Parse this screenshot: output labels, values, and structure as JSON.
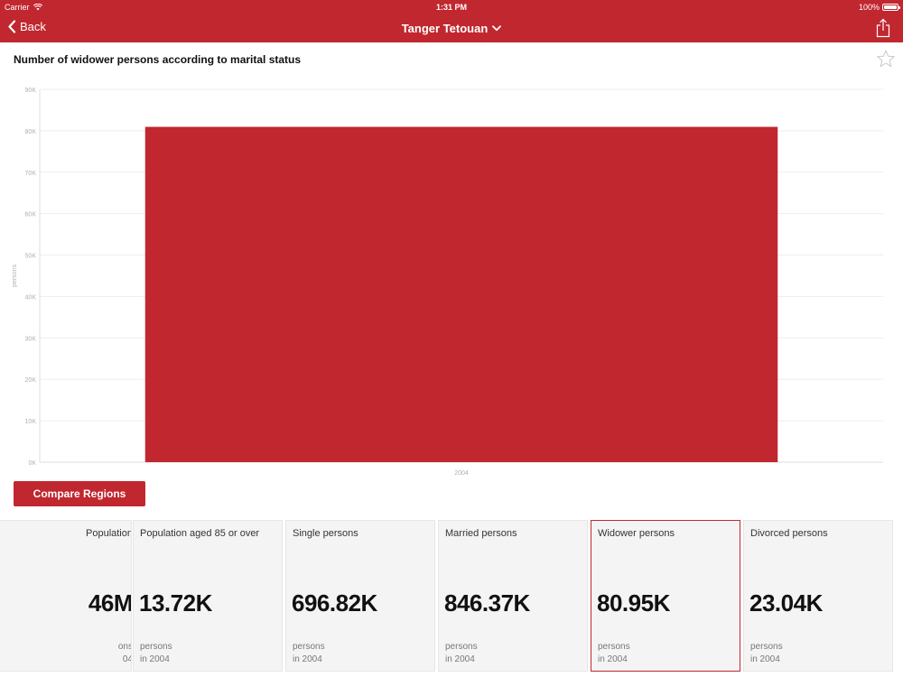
{
  "status_bar": {
    "carrier": "Carrier",
    "time": "1:31 PM",
    "battery": "100%"
  },
  "nav": {
    "back_label": "Back",
    "title": "Tanger Tetouan"
  },
  "colors": {
    "brand": "#c1272f",
    "grid": "#eeeeee",
    "axis_text": "#b0b0b0"
  },
  "chart_data": {
    "type": "bar",
    "title": "Number of widower persons according to marital status",
    "ylabel": "persons",
    "xlabel": "",
    "categories": [
      "2004"
    ],
    "values": [
      80950
    ],
    "ylim": [
      0,
      90000
    ],
    "y_ticks": [
      "0K",
      "10K",
      "20K",
      "30K",
      "40K",
      "50K",
      "60K",
      "70K",
      "80K",
      "90K"
    ],
    "grid": true,
    "bar_color": "#c1272f"
  },
  "compare_button": "Compare Regions",
  "cards": [
    {
      "label": "Population",
      "value": "46M",
      "unit": "ons",
      "year": "04",
      "clipped": true
    },
    {
      "label": "Population aged 85 or over",
      "value": "13.72K",
      "unit": "persons",
      "year": "in 2004"
    },
    {
      "label": "Single persons",
      "value": "696.82K",
      "unit": "persons",
      "year": "in 2004"
    },
    {
      "label": "Married persons",
      "value": "846.37K",
      "unit": "persons",
      "year": "in 2004"
    },
    {
      "label": "Widower persons",
      "value": "80.95K",
      "unit": "persons",
      "year": "in 2004",
      "selected": true
    },
    {
      "label": "Divorced persons",
      "value": "23.04K",
      "unit": "persons",
      "year": "in 2004"
    }
  ]
}
